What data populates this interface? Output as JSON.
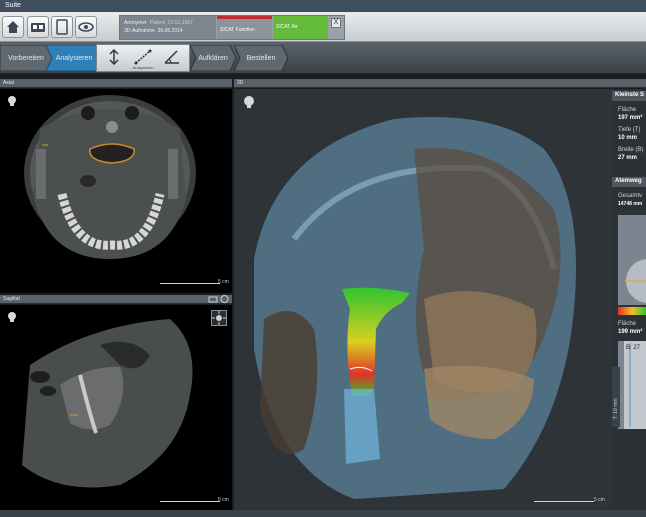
{
  "window": {
    "title": "Suite"
  },
  "toolbar": {
    "buttons": [
      {
        "icon": "home-icon"
      },
      {
        "icon": "scanner-icon"
      },
      {
        "icon": "tablet-icon"
      },
      {
        "icon": "eye-icon"
      }
    ],
    "patient": {
      "name_label": "Anonymer",
      "patient_label": "Patient",
      "birthdate": "01.01.1967",
      "volume_label": "3D-Aufnahme",
      "volume_date": "26.06.2014"
    },
    "sicat_function": "SICAT Function",
    "sicat_air": "SICAT Air",
    "close_label": "X"
  },
  "workflow": {
    "steps": [
      {
        "label": "Vorbereiten"
      },
      {
        "label": "Analysieren"
      },
      {
        "label": "Aufklären"
      },
      {
        "label": "Bestellen"
      }
    ],
    "subtools_label": "Analysieren"
  },
  "panels": {
    "axial": {
      "title": "Axial",
      "scale": "5 cm"
    },
    "sagittal": {
      "title": "Sagittal",
      "scale": "5 cm"
    },
    "view3d": {
      "title": "3D",
      "scale": "5 cm"
    }
  },
  "info": {
    "section1_title": "Kleinste S",
    "area_label": "Fläche",
    "area_value": "197 mm²",
    "depth_label": "Tiefe (T)",
    "depth_value": "10 mm",
    "width_label": "Breite (B)",
    "width_value": "27 mm",
    "section2_title": "Atemweg",
    "total_label": "Gesamtv",
    "total_value": "14748 mm",
    "area2_label": "Fläche",
    "area2_value": "199 mm²",
    "b_label": "B: 27",
    "t_label": "T: 10 mm"
  },
  "colors": {
    "accent_active": "#2f7fb8",
    "sicat_air": "#63ba3b",
    "sicat_function_bar": "#c32a34"
  }
}
